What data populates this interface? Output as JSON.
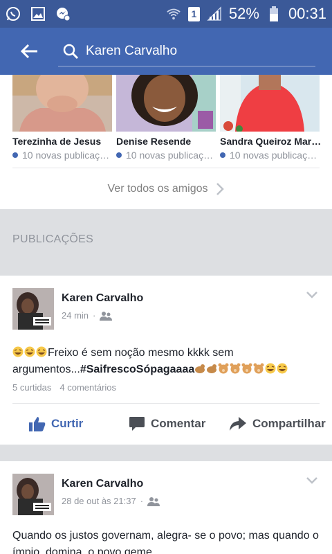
{
  "status_bar": {
    "battery": "52%",
    "time": "00:31",
    "sim": "1"
  },
  "app_bar": {
    "search_text": "Karen Carvalho"
  },
  "friends": [
    {
      "name": "Terezinha de Jesus",
      "sub": "10 novas publicaç…"
    },
    {
      "name": "Denise Resende",
      "sub": "10 novas publicaç…"
    },
    {
      "name": "Sandra Queiroz Mar…",
      "sub": "10 novas publicaç…"
    }
  ],
  "see_all_label": "Ver todos os amigos",
  "section_title": "PUBLICAÇÕES",
  "posts": [
    {
      "author": "Karen Carvalho",
      "time": "24 min",
      "text_main": "Freixo  é sem noção mesmo kkkk sem argumentos...",
      "hashtag": "#SaifrescoSópagaaaa",
      "likes": "5 curtidas",
      "comments": "4 comentários",
      "actions": {
        "like": "Curtir",
        "comment": "Comentar",
        "share": "Compartilhar"
      }
    },
    {
      "author": "Karen Carvalho",
      "time": "28 de out às 21:37",
      "text": "Quando os justos governam, alegra- se o povo; mas quando o ímpio, domina, o povo geme."
    }
  ],
  "colors": {
    "brand": "#3b5998",
    "appbar": "#4267b2",
    "like_blue": "#4267b2"
  },
  "icons": [
    "whatsapp-icon",
    "gallery-icon",
    "messenger-icon",
    "wifi-icon",
    "signal-icon",
    "battery-icon",
    "back-arrow-icon",
    "search-icon",
    "chevron-right-icon",
    "chevron-down-icon",
    "friends-privacy-icon",
    "like-icon",
    "comment-icon",
    "share-icon"
  ]
}
